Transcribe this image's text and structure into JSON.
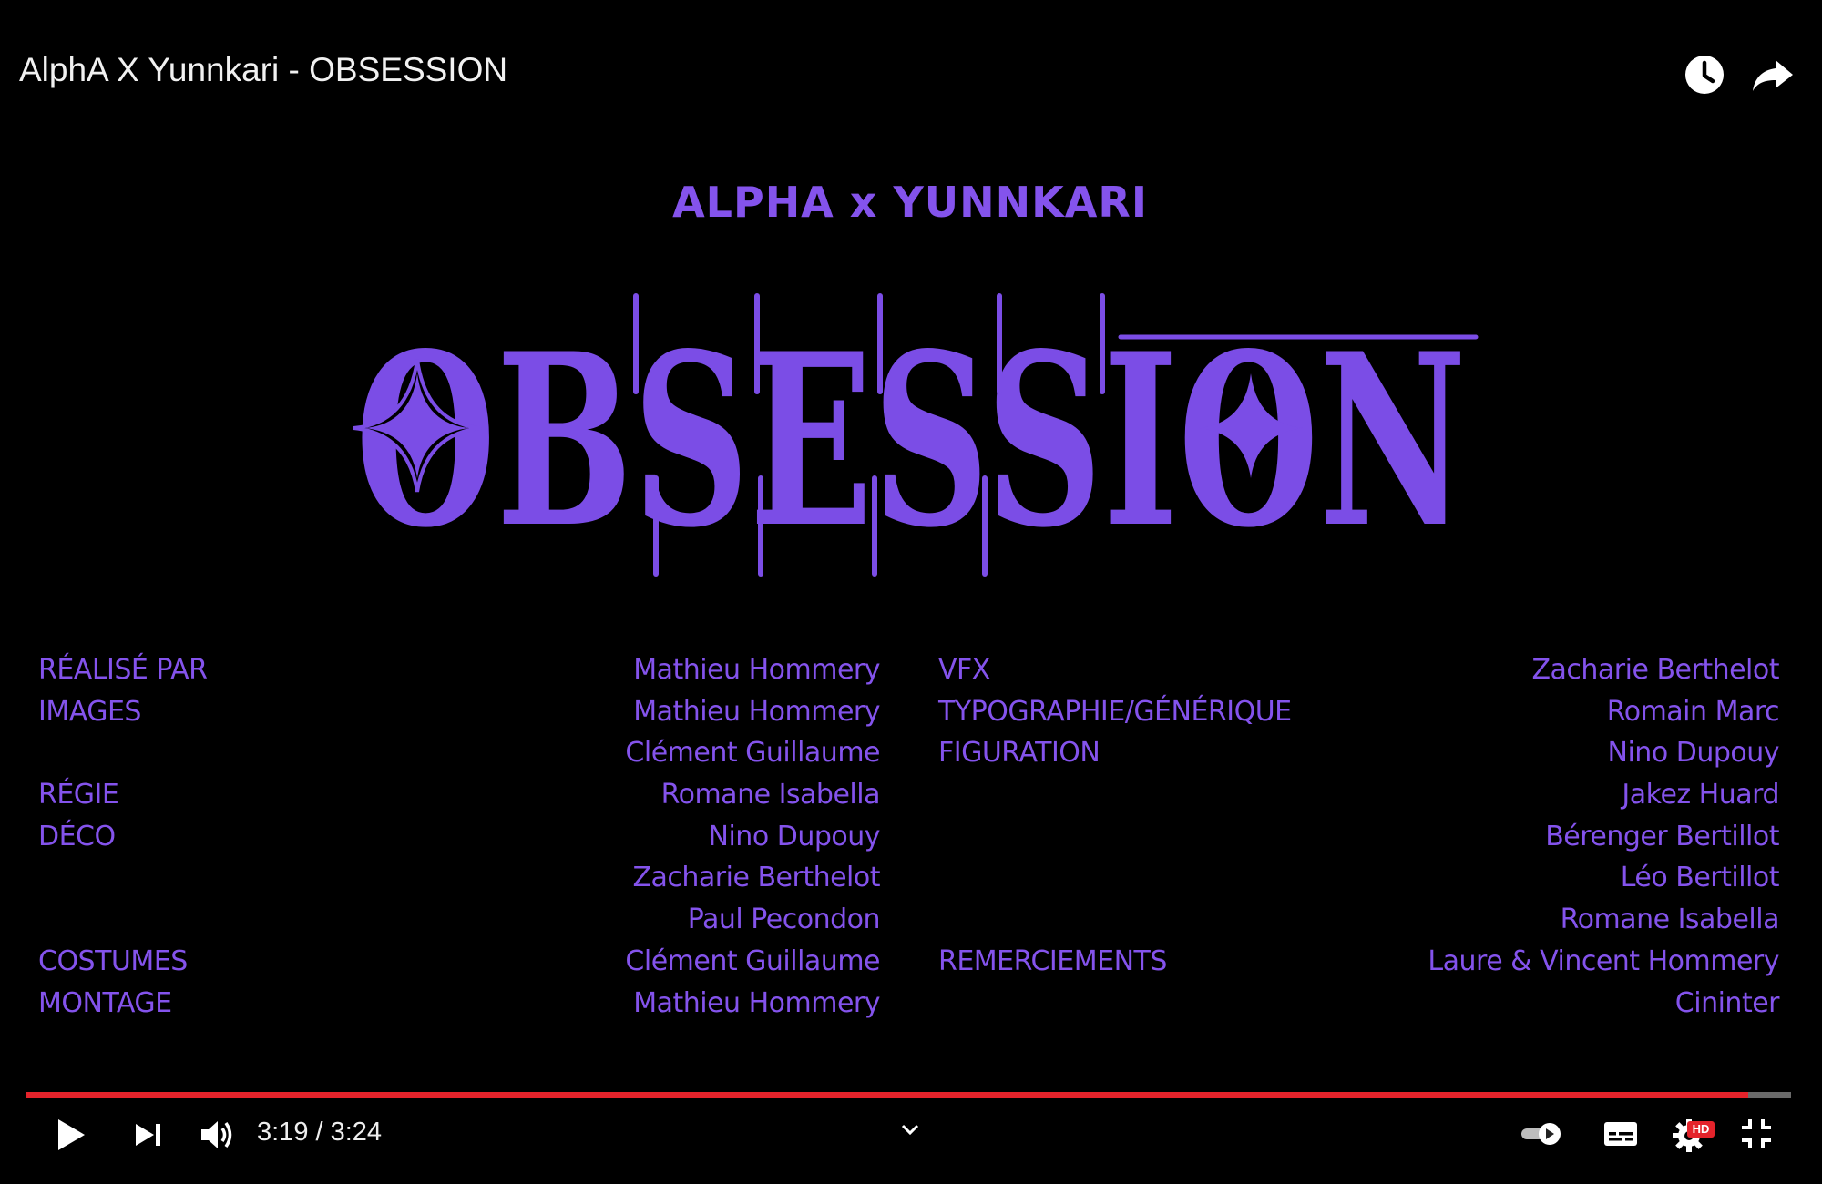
{
  "video": {
    "title": "AlphA X Yunnkari - OBSESSION"
  },
  "frame": {
    "artists": "ALPHA x YUNNKARI",
    "logo_text": "OBSESSION",
    "accent_color": "#8453ec",
    "credits_left": [
      {
        "role": "RÉALISÉ PAR",
        "name": "Mathieu Hommery"
      },
      {
        "role": "IMAGES",
        "name": "Mathieu Hommery"
      },
      {
        "role": "",
        "name": "Clément Guillaume"
      },
      {
        "role": "RÉGIE",
        "name": "Romane Isabella"
      },
      {
        "role": "DÉCO",
        "name": "Nino Dupouy"
      },
      {
        "role": "",
        "name": "Zacharie Berthelot"
      },
      {
        "role": "",
        "name": "Paul Pecondon"
      },
      {
        "role": "COSTUMES",
        "name": "Clément Guillaume"
      },
      {
        "role": "MONTAGE",
        "name": "Mathieu Hommery"
      }
    ],
    "credits_right": [
      {
        "role": "VFX",
        "name": "Zacharie Berthelot"
      },
      {
        "role": "TYPOGRAPHIE/GÉNÉRIQUE",
        "name": "Romain Marc"
      },
      {
        "role": "FIGURATION",
        "name": "Nino Dupouy"
      },
      {
        "role": "",
        "name": "Jakez Huard"
      },
      {
        "role": "",
        "name": "Bérenger Bertillot"
      },
      {
        "role": "",
        "name": "Léo Bertillot"
      },
      {
        "role": "",
        "name": "Romane Isabella"
      },
      {
        "role": "REMERCIEMENTS",
        "name": "Laure & Vincent Hommery"
      },
      {
        "role": "",
        "name": "Cininter"
      }
    ]
  },
  "player": {
    "current_time": "3:19",
    "duration": "3:24",
    "time_display": "3:19 / 3:24",
    "progress_fraction": 0.9755,
    "quality_badge": "HD",
    "progress_color": "#e4232b",
    "icons": [
      "watch-later-icon",
      "share-icon",
      "play-icon",
      "next-icon",
      "volume-icon",
      "chevron-down-icon",
      "autoplay-toggle-icon",
      "subtitles-icon",
      "settings-icon",
      "exit-fullscreen-icon"
    ]
  }
}
